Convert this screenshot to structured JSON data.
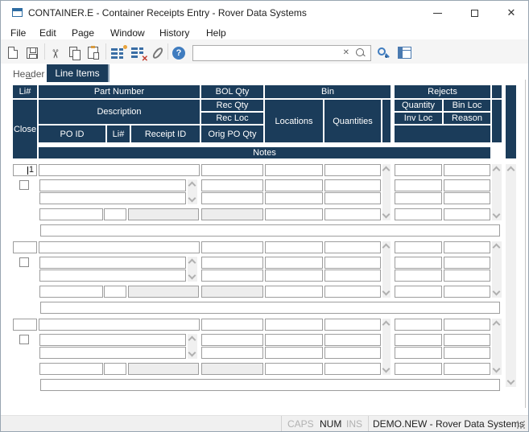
{
  "window": {
    "title": "CONTAINER.E - Container Receipts Entry - Rover Data Systems"
  },
  "menu": {
    "items": [
      "File",
      "Edit",
      "Page",
      "Window",
      "History",
      "Help"
    ]
  },
  "toolbar": {
    "icons": [
      "new-document",
      "save",
      "cut",
      "copy",
      "paste",
      "insert-row",
      "delete-row",
      "attachment",
      "help",
      "search-clear",
      "search-magnifier",
      "find-view",
      "layout-view"
    ],
    "search": {
      "value": ""
    }
  },
  "tabs": {
    "header_label": "Header",
    "line_items_label": "Line Items",
    "active": "Line Items"
  },
  "grid_header": {
    "li": "Li#",
    "part_number": "Part Number",
    "bol_qty": "BOL Qty",
    "bin": "Bin",
    "rejects": "Rejects",
    "close": "Close",
    "description": "Description",
    "rec_qty": "Rec Qty",
    "rec_loc": "Rec Loc",
    "locations": "Locations",
    "quantities": "Quantities",
    "quantity": "Quantity",
    "bin_loc": "Bin Loc",
    "inv_loc": "Inv Loc",
    "reason": "Reason",
    "po_id": "PO ID",
    "po_li": "Li#",
    "receipt_id": "Receipt ID",
    "orig_po_qty": "Orig PO Qty",
    "notes": "Notes"
  },
  "line_items": [
    {
      "li_no": "1",
      "part_number": "",
      "bol_qty": "",
      "closed": false,
      "description": [
        "",
        ""
      ],
      "rec_qty": "",
      "rec_loc": "",
      "po_id": "",
      "po_li_no": "",
      "receipt_id": "",
      "orig_po_qty": "",
      "bin_locations": [
        "",
        "",
        "",
        ""
      ],
      "bin_quantities": [
        "",
        "",
        "",
        ""
      ],
      "reject_quantities": [
        "",
        "",
        "",
        ""
      ],
      "reject_bin_locs": [
        "",
        "",
        "",
        ""
      ],
      "notes": ""
    },
    {
      "li_no": "",
      "part_number": "",
      "bol_qty": "",
      "closed": false,
      "description": [
        "",
        ""
      ],
      "rec_qty": "",
      "rec_loc": "",
      "po_id": "",
      "po_li_no": "",
      "receipt_id": "",
      "orig_po_qty": "",
      "bin_locations": [
        "",
        "",
        "",
        ""
      ],
      "bin_quantities": [
        "",
        "",
        "",
        ""
      ],
      "reject_quantities": [
        "",
        "",
        "",
        ""
      ],
      "reject_bin_locs": [
        "",
        "",
        "",
        ""
      ],
      "notes": ""
    },
    {
      "li_no": "",
      "part_number": "",
      "bol_qty": "",
      "closed": false,
      "description": [
        "",
        ""
      ],
      "rec_qty": "",
      "rec_loc": "",
      "po_id": "",
      "po_li_no": "",
      "receipt_id": "",
      "orig_po_qty": "",
      "bin_locations": [
        "",
        "",
        "",
        ""
      ],
      "bin_quantities": [
        "",
        "",
        "",
        ""
      ],
      "reject_quantities": [
        "",
        "",
        "",
        ""
      ],
      "reject_bin_locs": [
        "",
        "",
        "",
        ""
      ],
      "notes": ""
    }
  ],
  "status_bar": {
    "caps": "CAPS",
    "num": "NUM",
    "ins": "INS",
    "context": "DEMO.NEW - Rover Data Systems"
  },
  "colors": {
    "header_navy": "#1b3c5a",
    "disabled_field": "#ededed",
    "toolbar_bg": "#f5f5f5",
    "accent_blue": "#3f7cbf",
    "insert_dot_orange": "#e8a33d",
    "delete_x_red": "#c0392b"
  }
}
